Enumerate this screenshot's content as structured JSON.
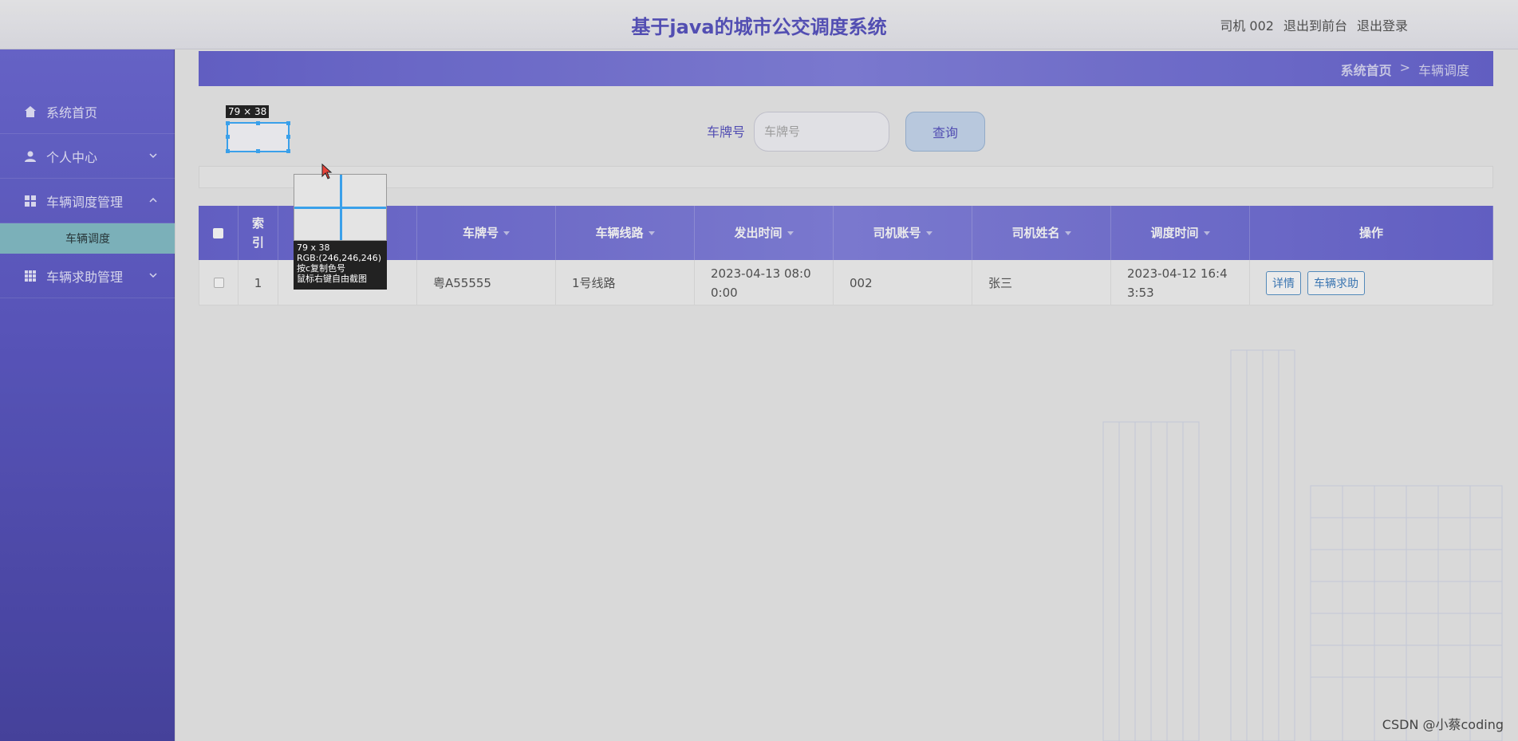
{
  "header": {
    "title": "基于java的城市公交调度系统",
    "links": [
      "司机 002",
      "退出到前台",
      "退出登录"
    ]
  },
  "sidebar": {
    "items": [
      {
        "label": "系统首页",
        "icon": "home-icon"
      },
      {
        "label": "个人中心",
        "icon": "user-icon"
      },
      {
        "label": "车辆调度管理",
        "icon": "grid-icon"
      },
      {
        "label": "车辆求助管理",
        "icon": "apps-icon"
      }
    ],
    "active_sub": "车辆调度"
  },
  "breadcrumb": {
    "home": "系统首页",
    "separator": ">",
    "current": "车辆调度"
  },
  "search": {
    "label": "车牌号",
    "placeholder": "车牌号",
    "button": "查询"
  },
  "table": {
    "headers": [
      "索引",
      "车牌号",
      "车辆线路",
      "发出时间",
      "司机账号",
      "司机姓名",
      "调度时间",
      "操作"
    ],
    "rows": [
      {
        "index": "1",
        "plate": "粤A55555",
        "route": "1号线路",
        "depart": "2023-04-13 08:00:00",
        "driver_account": "002",
        "driver_name": "张三",
        "dispatch_time": "2023-04-12 16:43:53",
        "actions": [
          "详情",
          "车辆求助"
        ]
      }
    ]
  },
  "capture_tool": {
    "size_label": "79 × 38",
    "mag_size": "79 x 38",
    "mag_rgb": "RGB:(246,246,246)",
    "mag_hint1": "按c复制色号",
    "mag_hint2": "鼠标右键自由截图"
  },
  "watermark": "CSDN @小蔡coding",
  "colors": {
    "accent": "#5a55c2",
    "sidebar": "#5e5ac6",
    "sub_active": "#86bfc9",
    "selection": "#3aa0ea"
  }
}
